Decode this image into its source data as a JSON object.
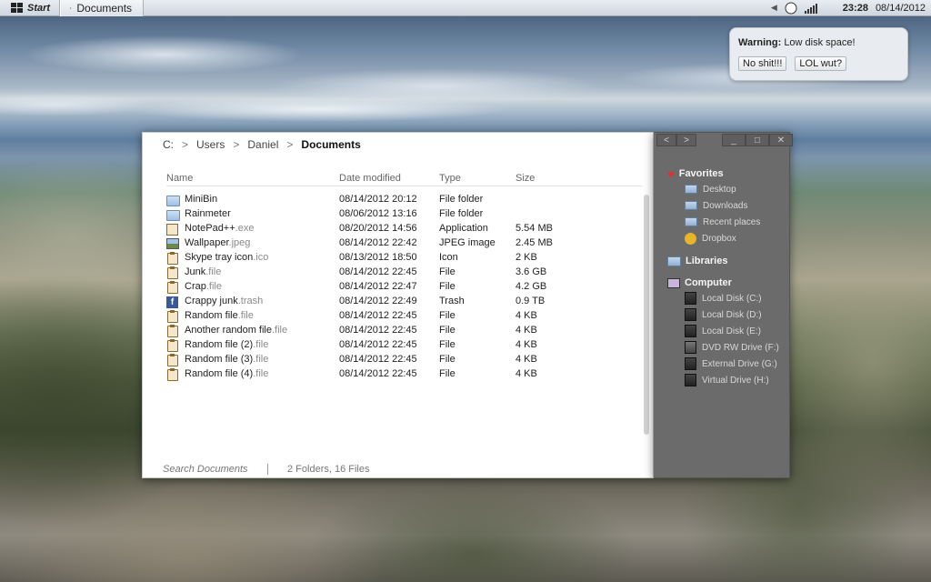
{
  "taskbar": {
    "start_label": "Start",
    "task_label": "Documents",
    "time": "23:28",
    "date": "08/14/2012"
  },
  "notification": {
    "title": "Warning:",
    "message": "Low disk space!",
    "button1": "No shit!!!",
    "button2": "LOL wut?"
  },
  "breadcrumb": [
    "C:",
    "Users",
    "Daniel",
    "Documents"
  ],
  "columns": {
    "name": "Name",
    "date": "Date modified",
    "type": "Type",
    "size": "Size"
  },
  "files": [
    {
      "name": "MiniBin",
      "ext": "",
      "date": "08/14/2012 20:12",
      "type": "File folder",
      "size": "",
      "icon": "folder-icon"
    },
    {
      "name": "Rainmeter",
      "ext": "",
      "date": "08/06/2012 13:16",
      "type": "File folder",
      "size": "",
      "icon": "folder-icon"
    },
    {
      "name": "NotePad++",
      "ext": ".exe",
      "date": "08/20/2012 14:56",
      "type": "Application",
      "size": "5.54 MB",
      "icon": "application-icon"
    },
    {
      "name": "Wallpaper",
      "ext": ".jpeg",
      "date": "08/14/2012 22:42",
      "type": "JPEG image",
      "size": "2.45 MB",
      "icon": "image-icon"
    },
    {
      "name": "Skype tray icon",
      "ext": ".ico",
      "date": "08/13/2012 18:50",
      "type": "Icon",
      "size": "2 KB",
      "icon": "file-icon"
    },
    {
      "name": "Junk",
      "ext": ".file",
      "date": "08/14/2012 22:45",
      "type": "File",
      "size": "3.6 GB",
      "icon": "file-icon"
    },
    {
      "name": "Crap",
      "ext": ".file",
      "date": "08/14/2012 22:47",
      "type": "File",
      "size": "4.2 GB",
      "icon": "file-icon"
    },
    {
      "name": "Crappy junk",
      "ext": ".trash",
      "date": "08/14/2012 22:49",
      "type": "Trash",
      "size": "0.9 TB",
      "icon": "trash-icon"
    },
    {
      "name": "Random file",
      "ext": ".file",
      "date": "08/14/2012 22:45",
      "type": "File",
      "size": "4 KB",
      "icon": "file-icon"
    },
    {
      "name": "Another random file",
      "ext": ".file",
      "date": "08/14/2012 22:45",
      "type": "File",
      "size": "4 KB",
      "icon": "file-icon"
    },
    {
      "name": "Random file (2)",
      "ext": ".file",
      "date": "08/14/2012 22:45",
      "type": "File",
      "size": "4 KB",
      "icon": "file-icon"
    },
    {
      "name": "Random file (3)",
      "ext": ".file",
      "date": "08/14/2012 22:45",
      "type": "File",
      "size": "4 KB",
      "icon": "file-icon"
    },
    {
      "name": "Random file (4)",
      "ext": ".file",
      "date": "08/14/2012 22:45",
      "type": "File",
      "size": "4 KB",
      "icon": "file-icon"
    }
  ],
  "status": {
    "search_placeholder": "Search Documents",
    "summary": "2 Folders, 16 Files"
  },
  "sidebar": {
    "favorites": {
      "label": "Favorites",
      "items": [
        "Desktop",
        "Downloads",
        "Recent places",
        "Dropbox"
      ]
    },
    "libraries": {
      "label": "Libraries"
    },
    "computer": {
      "label": "Computer",
      "items": [
        "Local Disk (C:)",
        "Local Disk (D:)",
        "Local Disk (E:)",
        "DVD RW Drive (F:)",
        "External Drive (G:)",
        "Virtual Drive (H:)"
      ]
    }
  }
}
